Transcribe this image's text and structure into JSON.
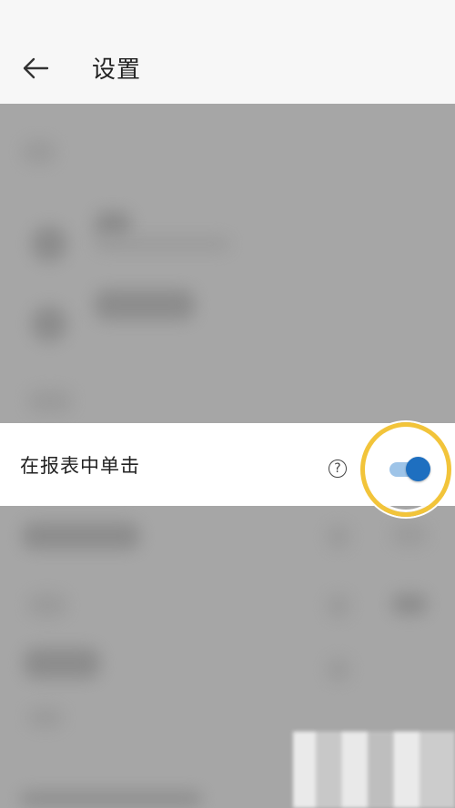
{
  "header": {
    "title": "设置",
    "back_icon": "arrow-left-icon"
  },
  "setting": {
    "label": "在报表中单击",
    "help_symbol": "?",
    "toggle_state": "on"
  },
  "colors": {
    "toggle_thumb": "#1e6fc0",
    "toggle_track": "#9ec4e8",
    "highlight_ring": "#f2c43a",
    "blur_overlay": "#a6a6a6"
  }
}
